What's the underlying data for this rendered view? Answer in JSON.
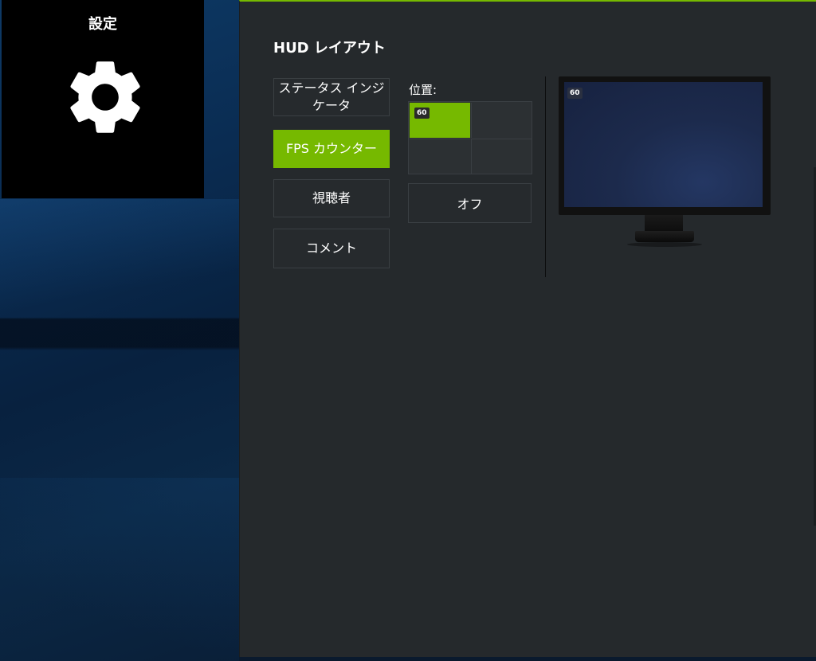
{
  "settings_tile": {
    "title": "設定",
    "icon": "gear-icon"
  },
  "panel": {
    "title": "HUD レイアウト",
    "accent_color": "#76b900",
    "side_buttons": [
      {
        "label": "ステータス インジケータ",
        "active": false
      },
      {
        "label": "FPS カウンター",
        "active": true
      },
      {
        "label": "視聴者",
        "active": false
      },
      {
        "label": "コメント",
        "active": false
      }
    ],
    "position_label": "位置:",
    "position_selected": "top-left",
    "fps_value": "60",
    "off_label": "オフ"
  }
}
